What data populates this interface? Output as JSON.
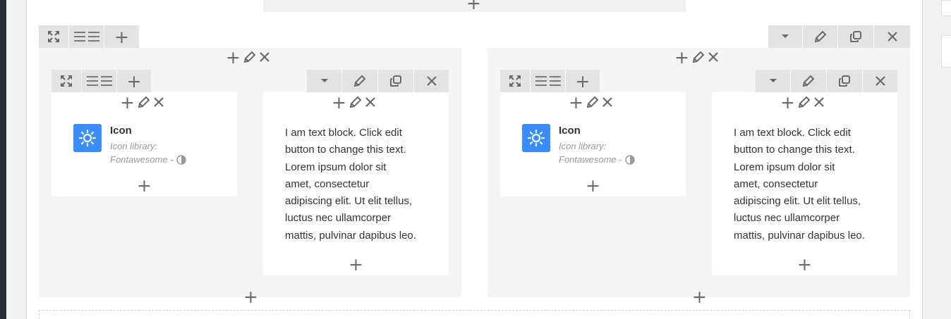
{
  "icons": {
    "expand": "expand-arrows-icon",
    "columns": "columns-icon",
    "add": "plus-icon",
    "dropdown": "caret-down-icon",
    "edit": "pencil-icon",
    "duplicate": "duplicate-icon",
    "delete": "close-icon",
    "sun": "sun-icon",
    "contrast": "half-circle-icon"
  },
  "colors": {
    "accent": "#3a8dfc",
    "toolbar_bg": "#e3e3e3",
    "row_bg": "#f4f4f4"
  },
  "rows": [
    {
      "icon_widget": {
        "title": "Icon",
        "subtitle_line1": "Icon library:",
        "subtitle_line2": "Fontawesome -"
      },
      "text_widget": {
        "lines": [
          "I am text block. Click edit",
          "button to change this text.",
          "Lorem ipsum dolor sit",
          "amet, consectetur",
          "adipiscing elit. Ut elit tellus,",
          "luctus nec ullamcorper",
          "mattis, pulvinar dapibus leo."
        ]
      }
    },
    {
      "icon_widget": {
        "title": "Icon",
        "subtitle_line1": "Icon library:",
        "subtitle_line2": "Fontawesome -"
      },
      "text_widget": {
        "lines": [
          "I am text block. Click edit",
          "button to change this text.",
          "Lorem ipsum dolor sit",
          "amet, consectetur",
          "adipiscing elit. Ut elit tellus,",
          "luctus nec ullamcorper",
          "mattis, pulvinar dapibus leo."
        ]
      }
    }
  ]
}
